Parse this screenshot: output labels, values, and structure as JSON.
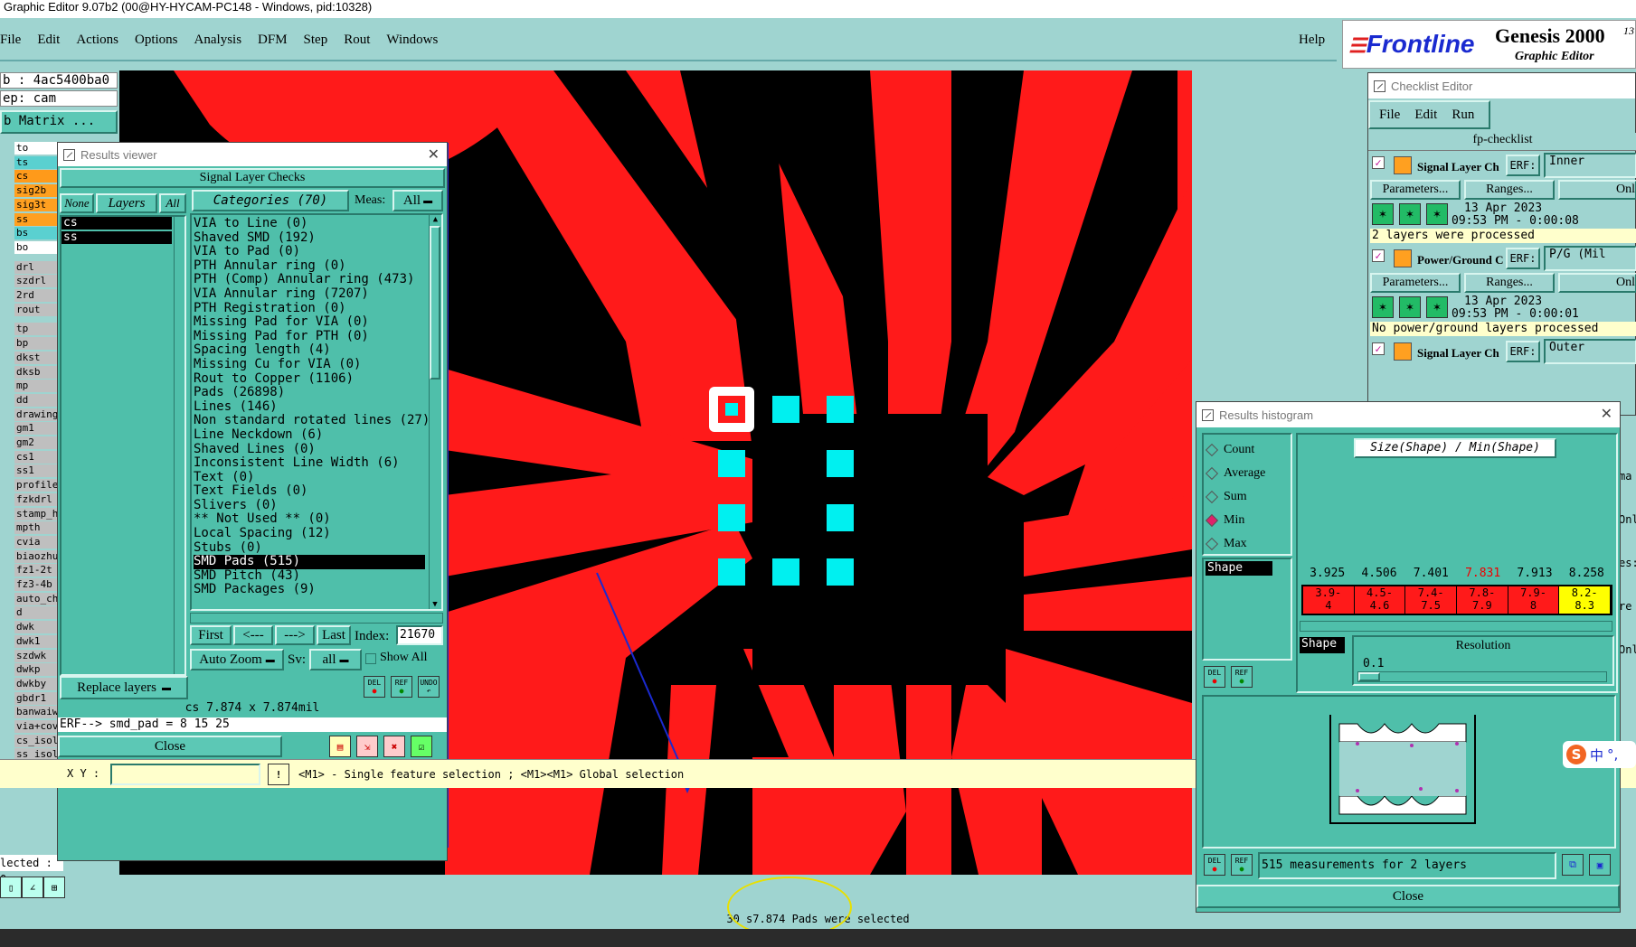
{
  "app": {
    "title": "Graphic Editor 9.07b2 (00@HY-HYCAM-PC148 - Windows, pid:10328)"
  },
  "menu": [
    "File",
    "Edit",
    "Actions",
    "Options",
    "Analysis",
    "DFM",
    "Step",
    "Rout",
    "Windows"
  ],
  "menu_help": "Help",
  "brand": {
    "logo": "Frontline",
    "product": "Genesis 2000",
    "sup": "13",
    "subtitle": "Graphic Editor"
  },
  "job": {
    "job_line": "b : 4ac5400ba0",
    "step_line": "ep: cam",
    "matrix_btn": "b Matrix ..."
  },
  "layers_panel": [
    {
      "name": "to",
      "color": "#ffffff"
    },
    {
      "name": "ts",
      "color": "#5ad0d0"
    },
    {
      "name": "cs",
      "color": "#ff9a1a"
    },
    {
      "name": "sig2b",
      "color": "#ffa020"
    },
    {
      "name": "sig3t",
      "color": "#ffa020"
    },
    {
      "name": "ss",
      "color": "#ffa020"
    },
    {
      "name": "bs",
      "color": "#5ad0d0"
    },
    {
      "name": "bo",
      "color": "#ffffff"
    },
    {
      "name": "drl",
      "color": "#bfbfbf"
    },
    {
      "name": "szdrl",
      "color": "#bfbfbf"
    },
    {
      "name": "2rd",
      "color": "#bfbfbf"
    },
    {
      "name": "rout",
      "color": "#bfbfbf"
    },
    {
      "name": "tp",
      "color": "#bfbfbf"
    },
    {
      "name": "bp",
      "color": "#bfbfbf"
    },
    {
      "name": "dkst",
      "color": "#bfbfbf"
    },
    {
      "name": "dksb",
      "color": "#bfbfbf"
    },
    {
      "name": "mp",
      "color": "#bfbfbf"
    },
    {
      "name": "dd",
      "color": "#bfbfbf"
    },
    {
      "name": "drawing",
      "color": "#bfbfbf"
    },
    {
      "name": "gm1",
      "color": "#bfbfbf"
    },
    {
      "name": "gm2",
      "color": "#bfbfbf"
    },
    {
      "name": "cs1",
      "color": "#bfbfbf"
    },
    {
      "name": "ss1",
      "color": "#bfbfbf"
    },
    {
      "name": "profile",
      "color": "#bfbfbf"
    },
    {
      "name": "fzkdrl",
      "color": "#bfbfbf"
    },
    {
      "name": "stamp_h",
      "color": "#bfbfbf"
    },
    {
      "name": "mpth",
      "color": "#bfbfbf"
    },
    {
      "name": "cvia",
      "color": "#bfbfbf"
    },
    {
      "name": "biaozhu",
      "color": "#bfbfbf"
    },
    {
      "name": "fz1-2t",
      "color": "#bfbfbf"
    },
    {
      "name": "fz3-4b",
      "color": "#bfbfbf"
    },
    {
      "name": "auto_ch",
      "color": "#bfbfbf"
    },
    {
      "name": "d",
      "color": "#bfbfbf"
    },
    {
      "name": "dwk",
      "color": "#bfbfbf"
    },
    {
      "name": "dwk1",
      "color": "#bfbfbf"
    },
    {
      "name": "szdwk",
      "color": "#bfbfbf"
    },
    {
      "name": "dwkp",
      "color": "#bfbfbf"
    },
    {
      "name": "dwkby",
      "color": "#bfbfbf"
    },
    {
      "name": "gbdr1",
      "color": "#bfbfbf"
    },
    {
      "name": "banwaiw",
      "color": "#bfbfbf"
    },
    {
      "name": "via+cov",
      "color": "#bfbfbf"
    },
    {
      "name": "cs_isol",
      "color": "#bfbfbf"
    },
    {
      "name": "ss_isol",
      "color": "#bfbfbf"
    }
  ],
  "selected_label": "lected : 0",
  "results_viewer": {
    "title": "Results viewer",
    "header": "Signal Layer Checks",
    "btn_none": "None",
    "btn_layers": "Layers",
    "btn_all": "All",
    "layers": [
      "cs",
      "ss"
    ],
    "categories_label": "Categories (70)",
    "meas_label": "Meas:",
    "meas_value": "All",
    "categories": [
      "VIA to Line (0)",
      "Shaved SMD (192)",
      "VIA to Pad (0)",
      "PTH Annular ring (0)",
      "PTH (Comp) Annular ring (473)",
      "VIA Annular ring (7207)",
      "PTH Registration (0)",
      "Missing Pad for VIA (0)",
      "Missing Pad for PTH (0)",
      "Spacing length (4)",
      "Missing Cu for VIA (0)",
      "Rout to Copper (1106)",
      "Pads (26898)",
      "Lines (146)",
      "Non standard rotated lines (27)",
      "Line Neckdown (6)",
      "Shaved Lines (0)",
      "Inconsistent Line Width (6)",
      "Text (0)",
      "Text Fields (0)",
      "Slivers (0)",
      "** Not Used ** (0)",
      "Local Spacing (12)",
      "Stubs (0)",
      "SMD Pads (515)",
      "SMD Pitch (43)",
      "SMD Packages (9)"
    ],
    "selected_index": 24,
    "nav": {
      "first": "First",
      "prev": "<---",
      "next": "--->",
      "last": "Last",
      "index_label": "Index:",
      "index_value": "21670"
    },
    "auto_zoom": "Auto Zoom",
    "sv_label": "Sv:",
    "sv_value": "all",
    "show_all": "Show All",
    "replace_layers": "Replace layers",
    "status": "cs 7.874 x 7.874mil",
    "erf_line": "ERF--> smd_pad = 8 15 25",
    "close": "Close",
    "icons": {
      "del": "DEL",
      "ref": "REF",
      "undo": "UNDO"
    }
  },
  "xy": {
    "label": "X Y :",
    "value": ""
  },
  "prompt": "<M1> - Single feature selection ; <M1><M1> Global selection",
  "status_msg": "30 s7.874 Pads were selected",
  "checklist": {
    "title": "Checklist Editor",
    "menu": [
      "File",
      "Edit",
      "Run"
    ],
    "name": "fp-checklist",
    "rows": [
      {
        "label": "Signal Layer Ch",
        "erf": "ERF:",
        "value": "Inner",
        "params": "Parameters...",
        "ranges": "Ranges...",
        "onl": "Onl",
        "date": "13 Apr 2023",
        "time": "09:53 PM - 0:00:08",
        "msg": "2 layers were processed"
      },
      {
        "label": "Power/Ground C",
        "erf": "ERF:",
        "value": "P/G (Mil",
        "params": "Parameters...",
        "ranges": "Ranges...",
        "onl": "Onl",
        "date": "13 Apr 2023",
        "time": "09:53 PM - 0:00:01",
        "msg": "No power/ground layers processed"
      },
      {
        "label": "Signal Layer Ch",
        "erf": "ERF:",
        "value": "Outer"
      }
    ],
    "edge_texts": [
      "ma",
      "Onl",
      "es:",
      "re",
      "Onl"
    ]
  },
  "histogram": {
    "title": "Results histogram",
    "options": [
      {
        "label": "Count",
        "on": false
      },
      {
        "label": "Average",
        "on": false
      },
      {
        "label": "Sum",
        "on": false
      },
      {
        "label": "Min",
        "on": true
      },
      {
        "label": "Max",
        "on": false
      }
    ],
    "shape_item": "Shape",
    "formula": "Size(Shape) / Min(Shape)",
    "values": [
      "3.925",
      "4.506",
      "7.401",
      "7.831",
      "7.913",
      "8.258"
    ],
    "bins": [
      {
        "top": "3.9-",
        "bot": "4",
        "color": "#ff1a1a"
      },
      {
        "top": "4.5-",
        "bot": "4.6",
        "color": "#ff1a1a"
      },
      {
        "top": "7.4-",
        "bot": "7.5",
        "color": "#ff1a1a"
      },
      {
        "top": "7.8-",
        "bot": "7.9",
        "color": "#ff1a1a"
      },
      {
        "top": "7.9-",
        "bot": "8",
        "color": "#ff1a1a"
      },
      {
        "top": "8.2-",
        "bot": "8.3",
        "color": "#ffff00"
      }
    ],
    "shape_label": "Shape",
    "resolution_label": "Resolution",
    "resolution_value": "0.1",
    "measurements": "515 measurements for 2 layers",
    "close": "Close"
  },
  "ime": {
    "label": "中",
    "extra": "°,"
  }
}
